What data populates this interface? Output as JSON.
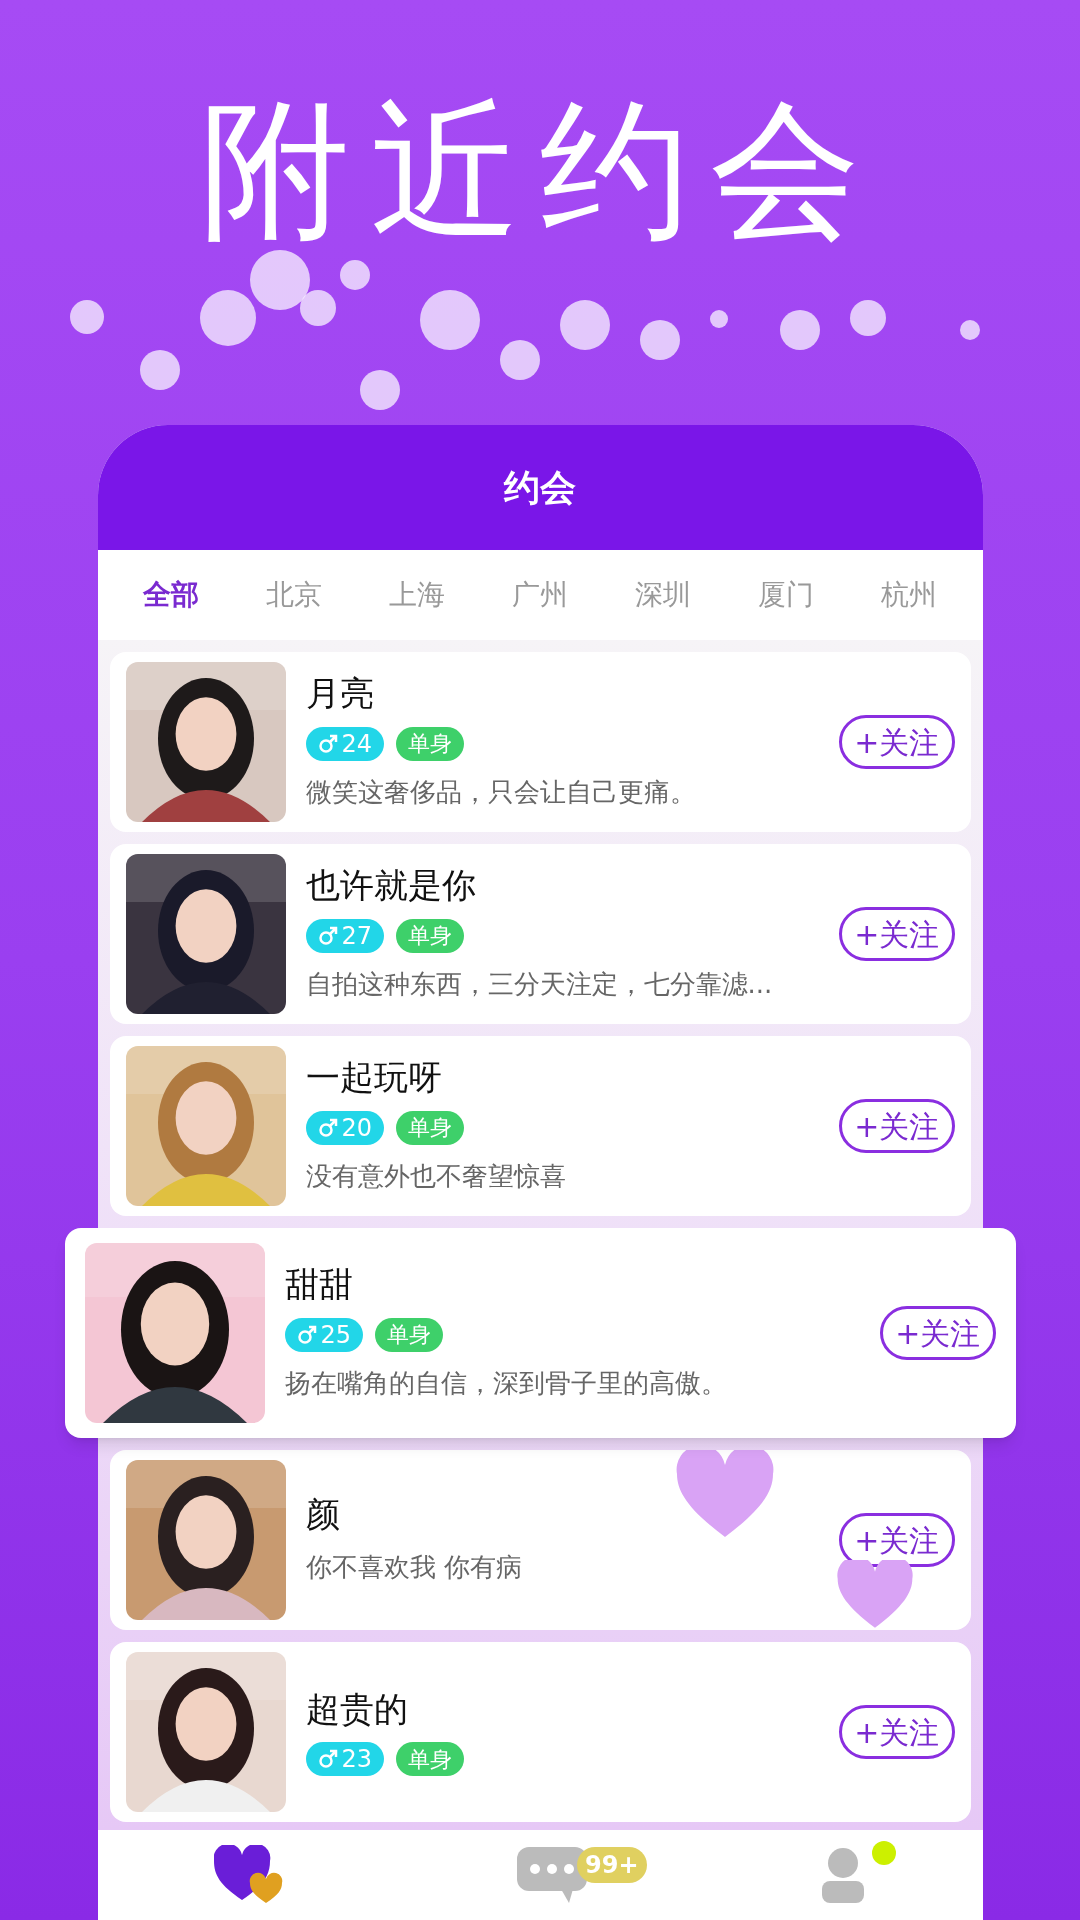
{
  "headline": "附近约会",
  "app": {
    "title": "约会"
  },
  "tabs": [
    {
      "label": "全部",
      "selected": true
    },
    {
      "label": "北京",
      "selected": false
    },
    {
      "label": "上海",
      "selected": false
    },
    {
      "label": "广州",
      "selected": false
    },
    {
      "label": "深圳",
      "selected": false
    },
    {
      "label": "厦门",
      "selected": false
    },
    {
      "label": "杭州",
      "selected": false
    }
  ],
  "users": [
    {
      "kind": "normal",
      "name": "月亮",
      "age": "24",
      "status": "单身",
      "bio": "微笑这奢侈品，只会让自己更痛。",
      "follow": "+关注"
    },
    {
      "kind": "normal",
      "name": "也许就是你",
      "age": "27",
      "status": "单身",
      "bio": "自拍这种东西，三分天注定，七分靠滤...",
      "follow": "+关注"
    },
    {
      "kind": "normal",
      "name": "一起玩呀",
      "age": "20",
      "status": "单身",
      "bio": "没有意外也不奢望惊喜",
      "follow": "+关注"
    },
    {
      "kind": "raised",
      "name": "甜甜",
      "age": "25",
      "status": "单身",
      "bio": "扬在嘴角的自信，深到骨子里的高傲。",
      "follow": "+关注"
    },
    {
      "kind": "covered",
      "name": "颜",
      "bio": "你不喜欢我 你有病",
      "follow": "+关注"
    },
    {
      "kind": "normal",
      "name": "超贵的",
      "age": "23",
      "status": "单身",
      "follow": "+关注"
    }
  ],
  "nav": {
    "badge": "99+"
  }
}
